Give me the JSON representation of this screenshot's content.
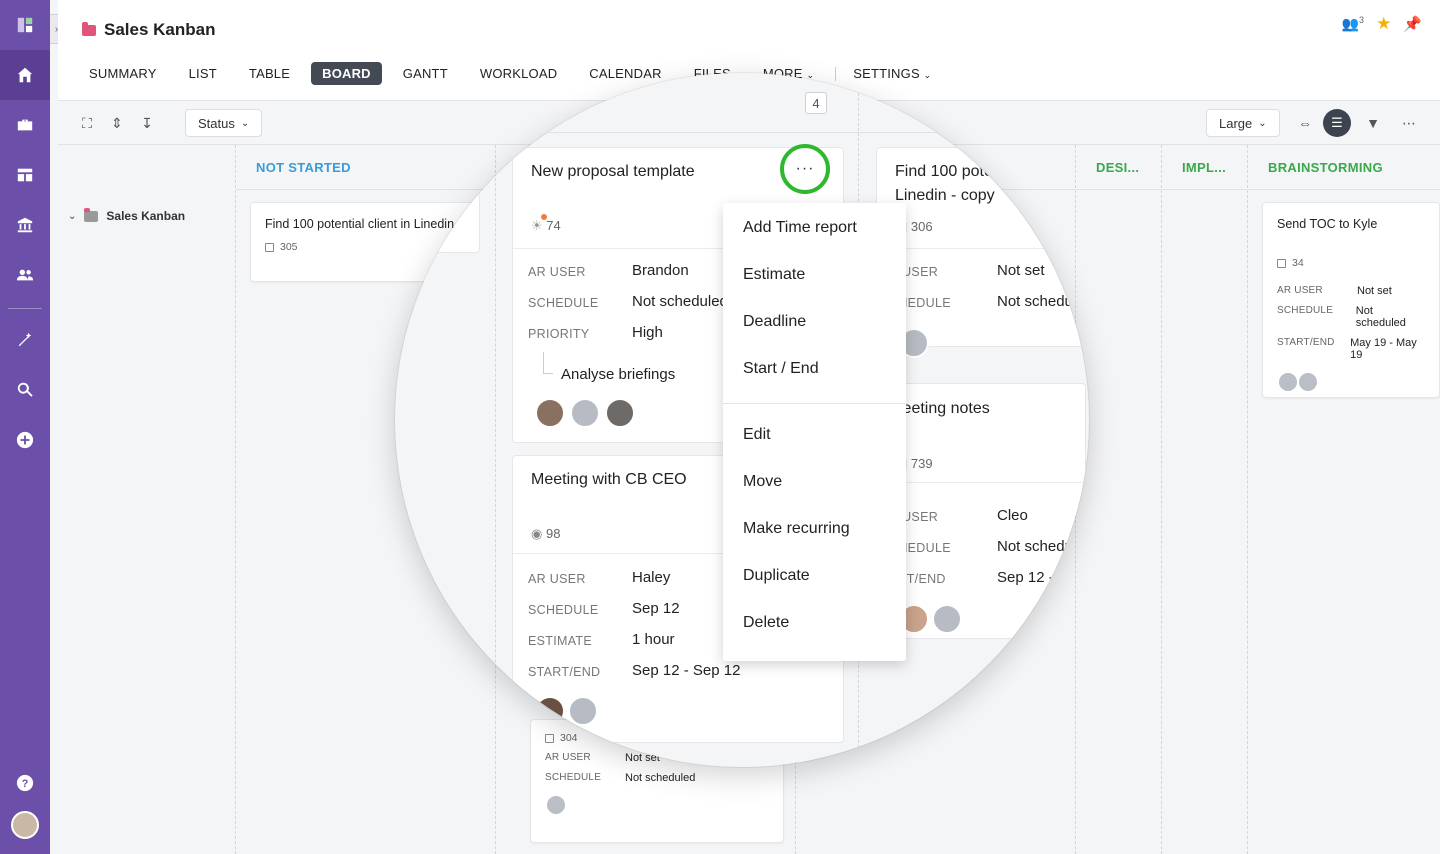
{
  "app": {
    "title": "Sales Kanban",
    "header_icons": [
      "users-icon",
      "star-icon",
      "pin-icon"
    ],
    "users_count": "3"
  },
  "tabs": [
    {
      "label": "SUMMARY"
    },
    {
      "label": "LIST"
    },
    {
      "label": "TABLE"
    },
    {
      "label": "BOARD",
      "active": true
    },
    {
      "label": "GANTT"
    },
    {
      "label": "WORKLOAD"
    },
    {
      "label": "CALENDAR"
    },
    {
      "label": "FILES"
    },
    {
      "label": "MORE"
    },
    {
      "label": "SETTINGS"
    }
  ],
  "toolbar": {
    "group_by": "Status",
    "size": "Large"
  },
  "tree": {
    "item": "Sales Kanban"
  },
  "columns": {
    "not_started": "NOT STARTED",
    "design": "DESI...",
    "implement": "IMPL...",
    "brainstorming": "BRAINSTORMING"
  },
  "cards": {
    "c1": {
      "title": "Find 100 potential client in Linedin",
      "id": "305"
    },
    "c304": {
      "id": "304",
      "ar_user_label": "AR USER",
      "ar_user": "Not set",
      "schedule_label": "SCHEDULE",
      "schedule": "Not scheduled"
    },
    "brain": {
      "title": "Send TOC to Kyle",
      "id": "34",
      "ar_user_label": "AR USER",
      "ar_user": "Not set",
      "schedule_label": "SCHEDULE",
      "schedule": "Not scheduled",
      "startend_label": "START/END",
      "startend": "May 19 - May 19"
    }
  },
  "magnified": {
    "count_badge": "4",
    "proposal": {
      "title": "New proposal template",
      "id": "74",
      "ar_user_label": "AR USER",
      "ar_user": "Brandon",
      "schedule_label": "SCHEDULE",
      "schedule": "Not scheduled",
      "priority_label": "PRIORITY",
      "priority": "High",
      "subtask": "Analyse briefings"
    },
    "meeting": {
      "title": "Meeting with CB CEO",
      "id": "98",
      "ar_user_label": "AR USER",
      "ar_user": "Haley",
      "schedule_label": "SCHEDULE",
      "schedule": "Sep 12",
      "estimate_label": "ESTIMATE",
      "estimate": "1 hour",
      "startend_label": "START/END",
      "startend": "Sep 12 - Sep 12"
    },
    "find_copy": {
      "title_line1": "Find 100 pote",
      "title_line2": "Linedin - copy",
      "id": "306",
      "ar_user_label": "R USER",
      "ar_user": "Not set",
      "schedule_label": "CHEDULE",
      "schedule": "Not schedu"
    },
    "notes": {
      "title": "leeting notes",
      "id": "739",
      "ar_user_label": "R USER",
      "ar_user": "Cleo",
      "schedule_label": "CHEDULE",
      "schedule": "Not schedu",
      "startend_label": "ART/END",
      "startend": "Sep 12 - S"
    },
    "menu": [
      "Add Time report",
      "Estimate",
      "Deadline",
      "Start / End",
      "Edit",
      "Move",
      "Make recurring",
      "Duplicate",
      "Delete"
    ],
    "more_button": "···"
  }
}
